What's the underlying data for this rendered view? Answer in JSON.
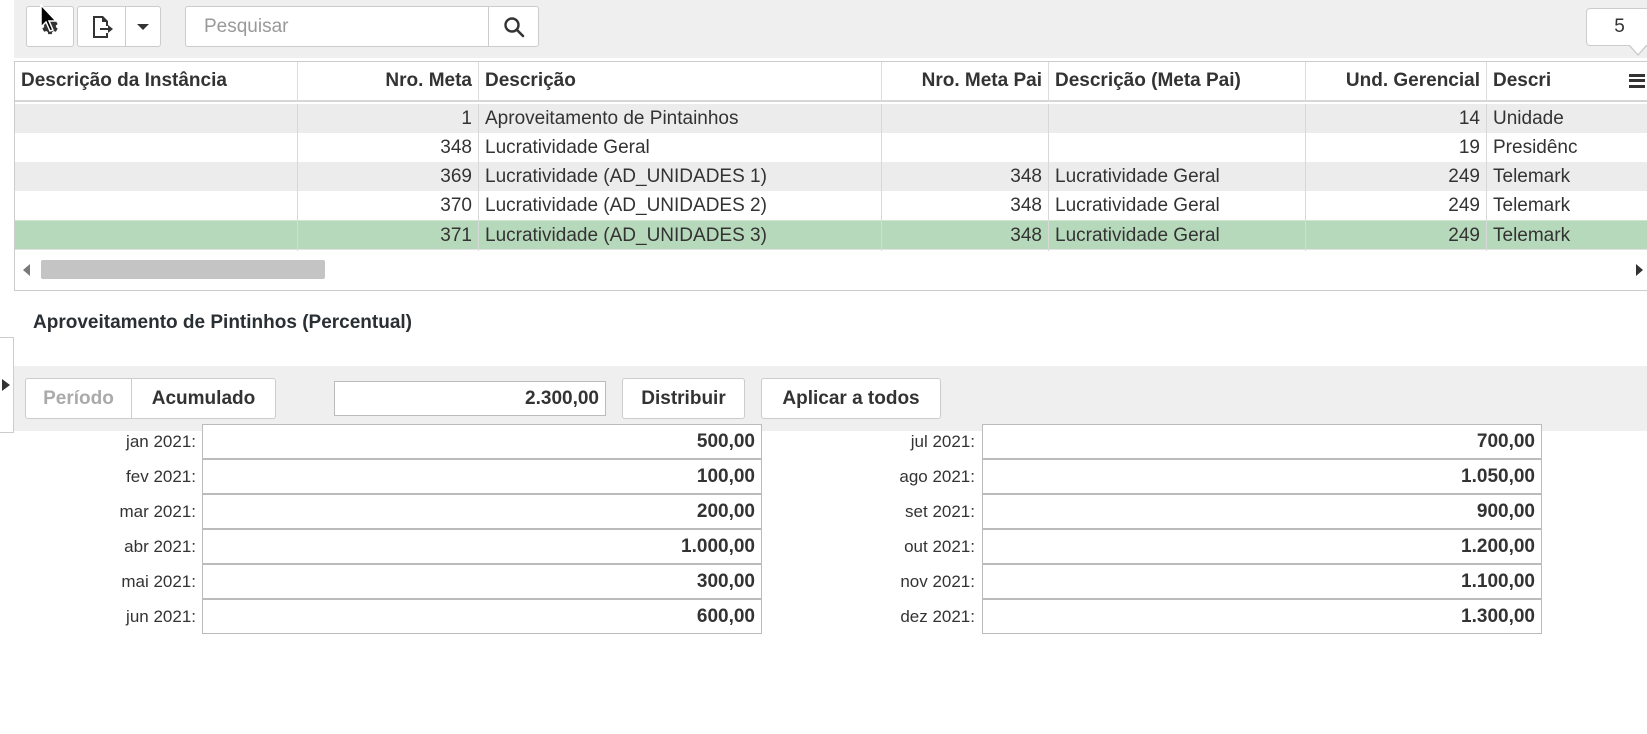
{
  "toolbar": {
    "search_placeholder": "Pesquisar",
    "record_count": "5",
    "icons": [
      "gear-icon",
      "export-file-icon",
      "caret-down-icon",
      "search-icon"
    ]
  },
  "grid": {
    "columns": [
      {
        "label": "Descrição da Instância"
      },
      {
        "label": "Nro. Meta"
      },
      {
        "label": "Descrição"
      },
      {
        "label": "Nro. Meta Pai"
      },
      {
        "label": "Descrição (Meta Pai)"
      },
      {
        "label": "Und. Gerencial"
      },
      {
        "label": "Descri"
      }
    ],
    "rows": [
      {
        "instancia": "",
        "nro_meta": "1",
        "descricao": "Aproveitamento de Pintainhos",
        "nro_meta_pai": "",
        "descricao_meta_pai": "",
        "und_gerencial": "14",
        "descricao_und": "Unidade"
      },
      {
        "instancia": "",
        "nro_meta": "348",
        "descricao": "Lucratividade Geral",
        "nro_meta_pai": "",
        "descricao_meta_pai": "",
        "und_gerencial": "19",
        "descricao_und": "Presidênc"
      },
      {
        "instancia": "",
        "nro_meta": "369",
        "descricao": "Lucratividade (AD_UNIDADES 1)",
        "nro_meta_pai": "348",
        "descricao_meta_pai": "Lucratividade Geral",
        "und_gerencial": "249",
        "descricao_und": "Telemark"
      },
      {
        "instancia": "",
        "nro_meta": "370",
        "descricao": "Lucratividade (AD_UNIDADES 2)",
        "nro_meta_pai": "348",
        "descricao_meta_pai": "Lucratividade Geral",
        "und_gerencial": "249",
        "descricao_und": "Telemark"
      },
      {
        "instancia": "",
        "nro_meta": "371",
        "descricao": "Lucratividade (AD_UNIDADES 3)",
        "nro_meta_pai": "348",
        "descricao_meta_pai": "Lucratividade Geral",
        "und_gerencial": "249",
        "descricao_und": "Telemark"
      }
    ],
    "selected_row": 4
  },
  "detail": {
    "title": "Aproveitamento de Pintinhos (Percentual)",
    "mode_periodo": "Período",
    "mode_acumulado": "Acumulado",
    "total_value": "2.300,00",
    "distribuir_label": "Distribuir",
    "aplicar_label": "Aplicar a todos",
    "months_left": [
      {
        "label": "jan 2021:",
        "value": "500,00"
      },
      {
        "label": "fev 2021:",
        "value": "100,00"
      },
      {
        "label": "mar 2021:",
        "value": "200,00"
      },
      {
        "label": "abr 2021:",
        "value": "1.000,00"
      },
      {
        "label": "mai 2021:",
        "value": "300,00"
      },
      {
        "label": "jun 2021:",
        "value": "600,00"
      }
    ],
    "months_right": [
      {
        "label": "jul 2021:",
        "value": "700,00"
      },
      {
        "label": "ago 2021:",
        "value": "1.050,00"
      },
      {
        "label": "set 2021:",
        "value": "900,00"
      },
      {
        "label": "out 2021:",
        "value": "1.200,00"
      },
      {
        "label": "nov 2021:",
        "value": "1.100,00"
      },
      {
        "label": "dez 2021:",
        "value": "1.300,00"
      }
    ]
  },
  "colors": {
    "toolbar_bg": "#efefef",
    "row_odd": "#ececec",
    "row_selected": "#b7d9bb"
  }
}
